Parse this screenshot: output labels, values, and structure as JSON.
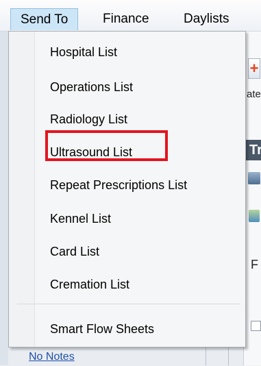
{
  "menubar": {
    "items": [
      {
        "label": "Send To",
        "active": true
      },
      {
        "label": "Finance",
        "active": false
      },
      {
        "label": "Daylists",
        "active": false
      }
    ]
  },
  "dropdown": {
    "items": [
      {
        "label": "Hospital List"
      },
      {
        "label": "Operations List"
      },
      {
        "label": "Radiology List",
        "highlighted": true
      },
      {
        "label": "Ultrasound List"
      },
      {
        "label": "Repeat Prescriptions List"
      },
      {
        "label": "Kennel List"
      },
      {
        "label": "Card List"
      },
      {
        "label": "Cremation List"
      },
      {
        "label": "Smart Flow Sheets"
      }
    ],
    "highlight_color": "#e4141f"
  },
  "background": {
    "plus_glyph": "+",
    "partial_text_ate": "ate",
    "partial_text_tr": "Tr",
    "partial_text_f": "F",
    "notes_link": "No Notes"
  },
  "colors": {
    "menubar_active_bg": "#cde6f7",
    "link_blue": "#1f4fa8"
  }
}
